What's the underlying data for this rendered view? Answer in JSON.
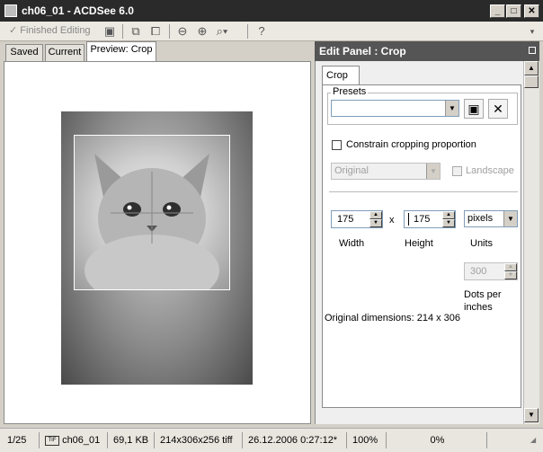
{
  "window": {
    "title": "ch06_01 - ACDSee 6.0",
    "minimize": "_",
    "maximize": "□",
    "close": "✕"
  },
  "toolbar": {
    "finished_editing": "Finished Editing"
  },
  "tabs": [
    {
      "label": "Saved"
    },
    {
      "label": "Current"
    },
    {
      "label": "Preview: Crop"
    }
  ],
  "panel": {
    "title": "Edit Panel : Crop",
    "tab": "Crop",
    "presets_label": "Presets",
    "presets_value": "",
    "constrain_label": "Constrain cropping proportion",
    "proportion_value": "Original",
    "landscape_label": "Landscape",
    "width_value": "175",
    "height_value": "175",
    "x_label": "x",
    "units_value": "pixels",
    "width_label": "Width",
    "height_label": "Height",
    "units_label": "Units",
    "dpi_value": "300",
    "dpi_label_1": "Dots per",
    "dpi_label_2": "inches",
    "original_dimensions": "Original dimensions: 214 x 306"
  },
  "status": {
    "index": "1/25",
    "filename": "ch06_01",
    "filesize": "69,1 KB",
    "format": "214x306x256 tiff",
    "datetime": "26.12.2006 0:27:12*",
    "zoom": "100%",
    "progress": "0%",
    "format_icon": "tiff-icon"
  }
}
